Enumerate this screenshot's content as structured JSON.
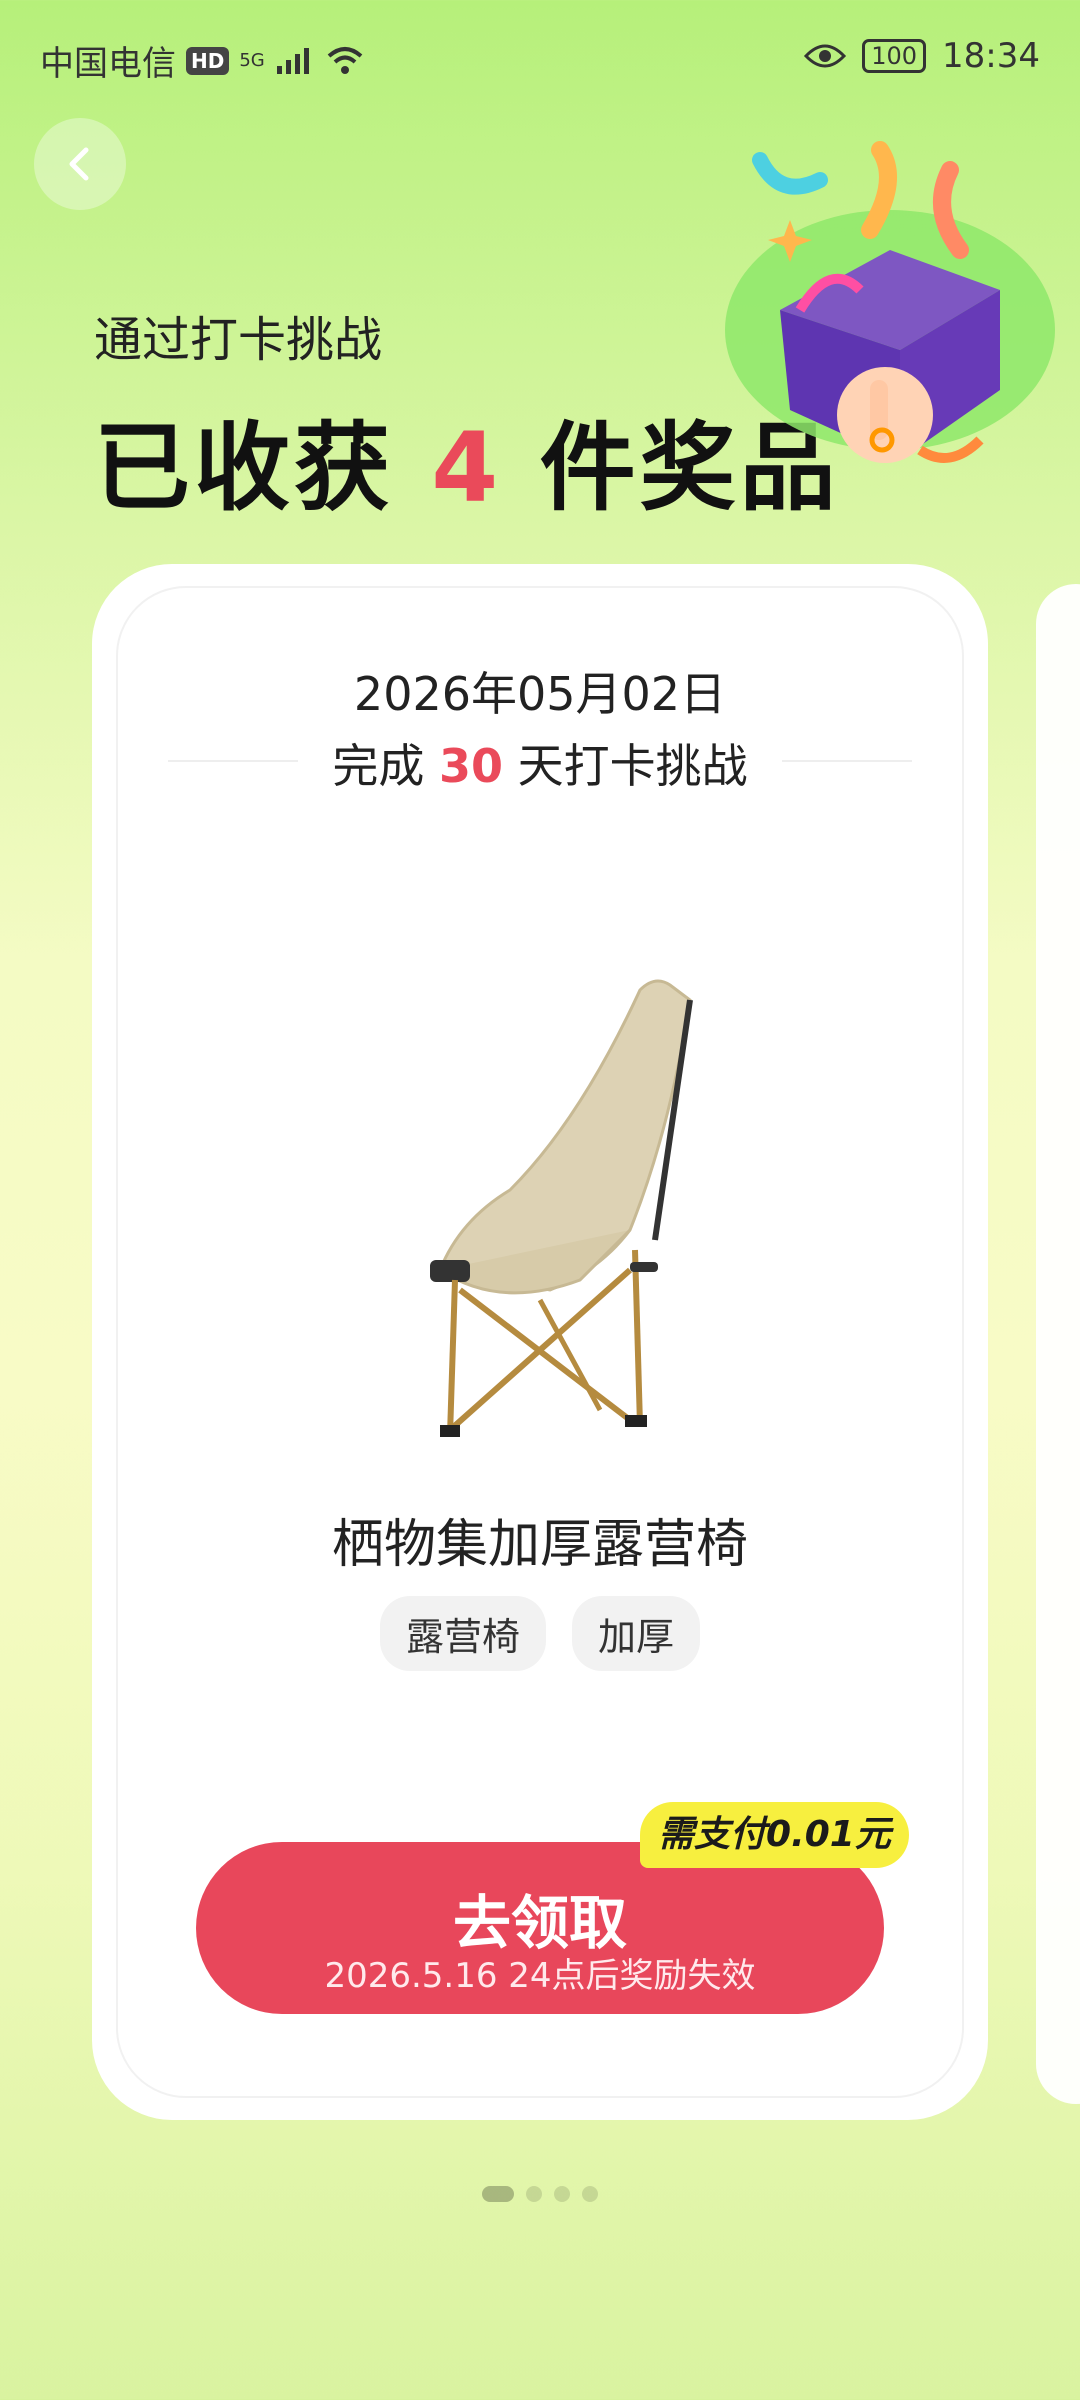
{
  "status_bar": {
    "carrier": "中国电信",
    "hd": "HD",
    "network": "5G",
    "battery": "100",
    "time": "18:34"
  },
  "header": {
    "subtitle": "通过打卡挑战",
    "headline_prefix": "已收获",
    "prize_count": "4",
    "headline_suffix": "件奖品"
  },
  "card": {
    "date": "2026年05月02日",
    "challenge_prefix": "完成",
    "challenge_days": "30",
    "challenge_suffix": "天打卡挑战",
    "product_name": "栖物集加厚露营椅",
    "tags": [
      "露营椅",
      "加厚"
    ],
    "pay_badge": "需支付0.01元",
    "claim_label": "去领取",
    "claim_expiry": "2026.5.16 24点后奖励失效"
  },
  "pagination": {
    "total": 4,
    "current": 1
  },
  "colors": {
    "accent": "#e8475b",
    "badge": "#f7ef3f",
    "highlight": "#ea4a5a"
  },
  "icons": [
    "back-arrow-icon",
    "eye-icon",
    "wifi-icon",
    "signal-icon"
  ]
}
